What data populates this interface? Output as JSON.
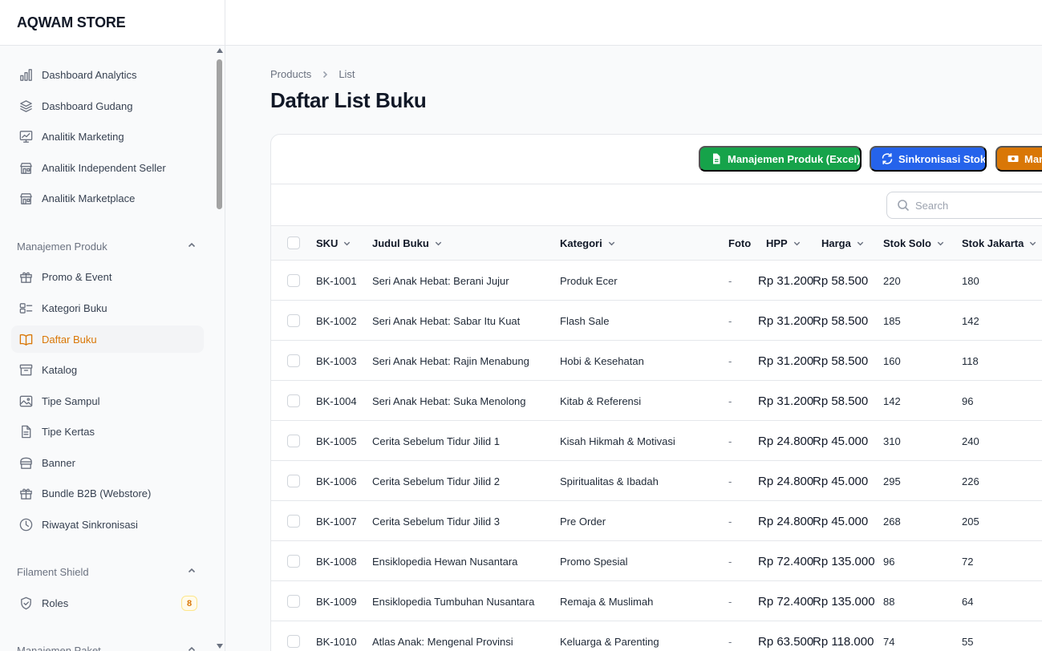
{
  "app": {
    "brand": "AQWAM STORE"
  },
  "sidebar": {
    "top_items": [
      {
        "label": "Dashboard Analytics",
        "icon": "chart-bar-icon"
      },
      {
        "label": "Dashboard Gudang",
        "icon": "stack-icon"
      },
      {
        "label": "Analitik Marketing",
        "icon": "trend-chart-icon"
      },
      {
        "label": "Analitik Independent Seller",
        "icon": "store-icon"
      },
      {
        "label": "Analitik Marketplace",
        "icon": "store-icon"
      }
    ],
    "group_produk": {
      "label": "Manajemen Produk",
      "items": [
        {
          "label": "Promo & Event",
          "icon": "gift-icon"
        },
        {
          "label": "Kategori Buku",
          "icon": "tags-icon"
        },
        {
          "label": "Daftar Buku",
          "icon": "book-open-icon",
          "active": true
        },
        {
          "label": "Katalog",
          "icon": "archive-box-icon"
        },
        {
          "label": "Tipe Sampul",
          "icon": "image-icon"
        },
        {
          "label": "Tipe Kertas",
          "icon": "document-icon"
        },
        {
          "label": "Banner",
          "icon": "banner-icon"
        },
        {
          "label": "Bundle B2B (Webstore)",
          "icon": "gift-icon"
        },
        {
          "label": "Riwayat Sinkronisasi",
          "icon": "clock-icon"
        }
      ]
    },
    "group_shield": {
      "label": "Filament Shield",
      "items": [
        {
          "label": "Roles",
          "icon": "shield-check-icon",
          "badge": "8"
        }
      ]
    },
    "group_paket": {
      "label": "Manajemen Paket"
    }
  },
  "breadcrumb": {
    "items": [
      "Products",
      "List"
    ]
  },
  "page": {
    "title": "Daftar List Buku"
  },
  "toolbar": {
    "excel_label": "Manajemen Produk (Excel)",
    "sync_label": "Sinkronisasi Stok",
    "third_label": "Man"
  },
  "search": {
    "placeholder": "Search",
    "value": ""
  },
  "table": {
    "headers": {
      "sku": "SKU",
      "judul": "Judul Buku",
      "kategori": "Kategori",
      "foto": "Foto",
      "hpp": "HPP",
      "harga": "Harga",
      "stok_solo": "Stok Solo",
      "stok_jakarta": "Stok Jakarta"
    },
    "rows": [
      {
        "sku": "BK-1001",
        "judul": "Seri Anak Hebat: Berani Jujur",
        "kategori": "Produk Ecer",
        "foto": "-",
        "hpp": "Rp 31.200",
        "harga": "Rp 58.500",
        "stok_solo": "220",
        "stok_jakarta": "180"
      },
      {
        "sku": "BK-1002",
        "judul": "Seri Anak Hebat: Sabar Itu Kuat",
        "kategori": "Flash Sale",
        "foto": "-",
        "hpp": "Rp 31.200",
        "harga": "Rp 58.500",
        "stok_solo": "185",
        "stok_jakarta": "142"
      },
      {
        "sku": "BK-1003",
        "judul": "Seri Anak Hebat: Rajin Menabung",
        "kategori": "Hobi & Kesehatan",
        "foto": "-",
        "hpp": "Rp 31.200",
        "harga": "Rp 58.500",
        "stok_solo": "160",
        "stok_jakarta": "118"
      },
      {
        "sku": "BK-1004",
        "judul": "Seri Anak Hebat: Suka Menolong",
        "kategori": "Kitab & Referensi",
        "foto": "-",
        "hpp": "Rp 31.200",
        "harga": "Rp 58.500",
        "stok_solo": "142",
        "stok_jakarta": "96"
      },
      {
        "sku": "BK-1005",
        "judul": "Cerita Sebelum Tidur Jilid 1",
        "kategori": "Kisah Hikmah & Motivasi",
        "foto": "-",
        "hpp": "Rp 24.800",
        "harga": "Rp 45.000",
        "stok_solo": "310",
        "stok_jakarta": "240"
      },
      {
        "sku": "BK-1006",
        "judul": "Cerita Sebelum Tidur Jilid 2",
        "kategori": "Spiritualitas & Ibadah",
        "foto": "-",
        "hpp": "Rp 24.800",
        "harga": "Rp 45.000",
        "stok_solo": "295",
        "stok_jakarta": "226"
      },
      {
        "sku": "BK-1007",
        "judul": "Cerita Sebelum Tidur Jilid 3",
        "kategori": "Pre Order",
        "foto": "-",
        "hpp": "Rp 24.800",
        "harga": "Rp 45.000",
        "stok_solo": "268",
        "stok_jakarta": "205"
      },
      {
        "sku": "BK-1008",
        "judul": "Ensiklopedia Hewan Nusantara",
        "kategori": "Promo Spesial",
        "foto": "-",
        "hpp": "Rp 72.400",
        "harga": "Rp 135.000",
        "stok_solo": "96",
        "stok_jakarta": "72"
      },
      {
        "sku": "BK-1009",
        "judul": "Ensiklopedia Tumbuhan Nusantara",
        "kategori": "Remaja & Muslimah",
        "foto": "-",
        "hpp": "Rp 72.400",
        "harga": "Rp 135.000",
        "stok_solo": "88",
        "stok_jakarta": "64"
      },
      {
        "sku": "BK-1010",
        "judul": "Atlas Anak: Mengenal Provinsi",
        "kategori": "Keluarga & Parenting",
        "foto": "-",
        "hpp": "Rp 63.500",
        "harga": "Rp 118.000",
        "stok_solo": "74",
        "stok_jakarta": "55"
      }
    ]
  },
  "colors": {
    "accent": "#d97706",
    "success": "#16a34a",
    "primary": "#2563eb"
  }
}
